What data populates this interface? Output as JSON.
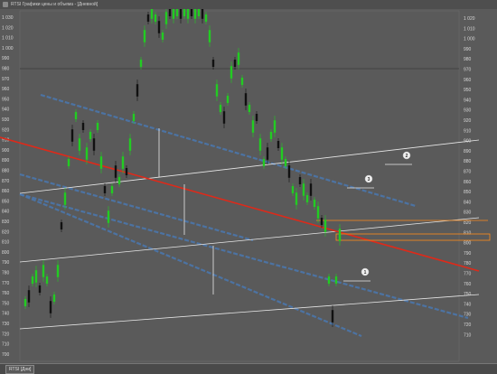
{
  "window": {
    "title": "RTSI Графики цены и объема - [Дневной]"
  },
  "status_tab": {
    "label": "RTSI [Дни]"
  },
  "colors": {
    "background": "#5a5a5a",
    "up_candle": "#22cc22",
    "down_candle": "#111111",
    "trend_blue": "#4a78b0",
    "trend_red": "#dd2a1a",
    "trend_white": "#e8e8e8",
    "orange_box": "#ff8c1a"
  },
  "axes": {
    "left_ticks": [
      "1 030",
      "1 020",
      "1 010",
      "1 000",
      "990",
      "980",
      "970",
      "960",
      "950",
      "940",
      "930",
      "920",
      "910",
      "900",
      "890",
      "880",
      "870",
      "860",
      "850",
      "840",
      "830",
      "820",
      "810",
      "800",
      "790",
      "780",
      "770",
      "760",
      "750",
      "740",
      "730",
      "720",
      "710",
      "700"
    ],
    "right_ticks": [
      "1 020",
      "1 010",
      "1 000",
      "990",
      "980",
      "970",
      "960",
      "950",
      "940",
      "930",
      "920",
      "910",
      "900",
      "890",
      "880",
      "870",
      "860",
      "850",
      "840",
      "830",
      "820",
      "810",
      "800",
      "790",
      "780",
      "770",
      "760",
      "750",
      "740",
      "730",
      "720",
      "710"
    ],
    "right_top_label": "1 030"
  },
  "markers": [
    {
      "label": "1"
    },
    {
      "label": "2"
    },
    {
      "label": "3"
    }
  ]
}
